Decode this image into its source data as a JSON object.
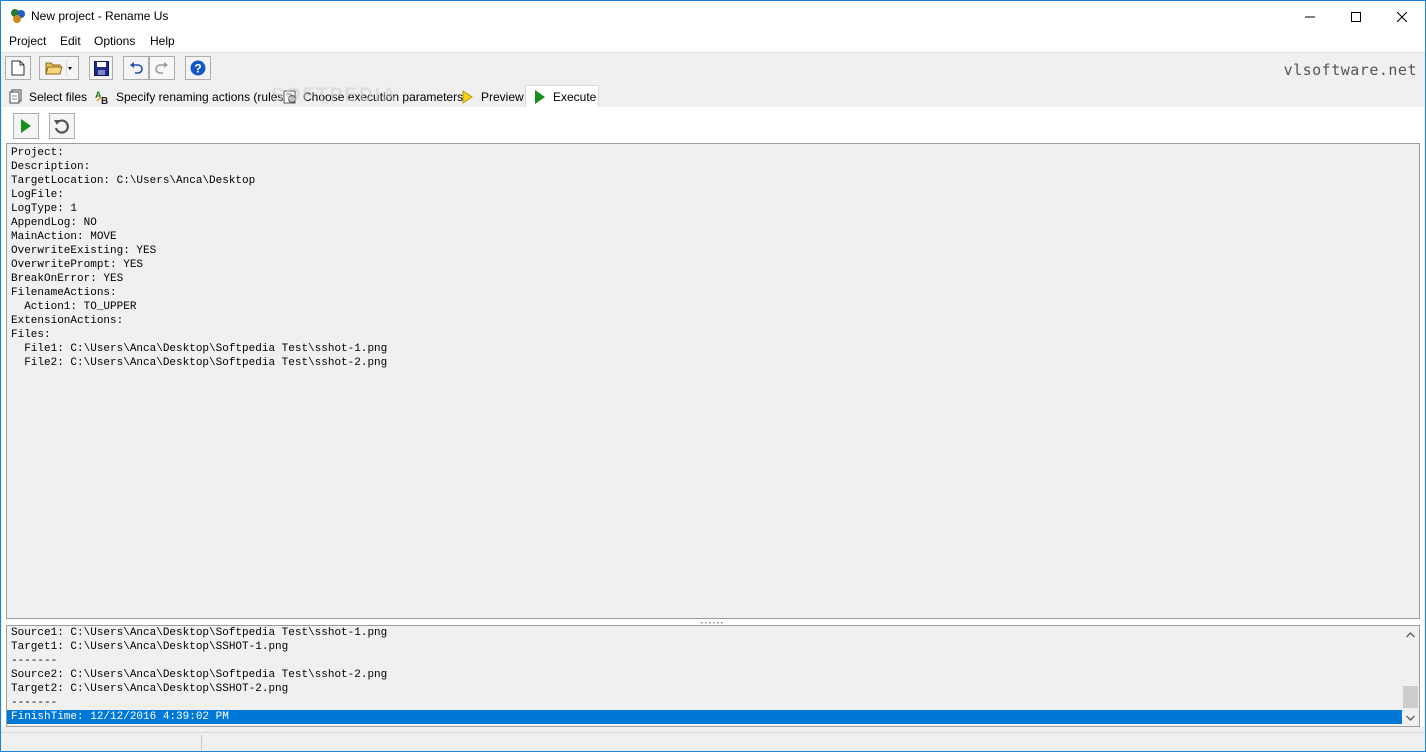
{
  "window": {
    "title": "New project - Rename Us"
  },
  "menu": [
    "Project",
    "Edit",
    "Options",
    "Help"
  ],
  "toolbar": {
    "brand": "vlsoftware.net"
  },
  "tabs": [
    {
      "label": "Select files",
      "icon": "files-icon"
    },
    {
      "label": "Specify renaming actions (rules)",
      "icon": "ab-rules-icon"
    },
    {
      "label": "Choose execution parameters",
      "icon": "parameters-icon"
    },
    {
      "label": "Preview",
      "icon": "preview-icon"
    },
    {
      "label": "Execute",
      "icon": "execute-icon",
      "active": true
    }
  ],
  "watermark": "SOFTPEDIA",
  "report_lines": [
    "Project:",
    "Description:",
    "TargetLocation: C:\\Users\\Anca\\Desktop",
    "LogFile:",
    "LogType: 1",
    "AppendLog: NO",
    "MainAction: MOVE",
    "OverwriteExisting: YES",
    "OverwritePrompt: YES",
    "BreakOnError: YES",
    "FilenameActions:",
    "  Action1: TO_UPPER",
    "ExtensionActions:",
    "Files:",
    "  File1: C:\\Users\\Anca\\Desktop\\Softpedia Test\\sshot-1.png",
    "  File2: C:\\Users\\Anca\\Desktop\\Softpedia Test\\sshot-2.png"
  ],
  "log_lines": [
    "Source1: C:\\Users\\Anca\\Desktop\\Softpedia Test\\sshot-1.png",
    "Target1: C:\\Users\\Anca\\Desktop\\SSHOT-1.png",
    "-------",
    "Source2: C:\\Users\\Anca\\Desktop\\Softpedia Test\\sshot-2.png",
    "Target2: C:\\Users\\Anca\\Desktop\\SSHOT-2.png",
    "-------",
    "FinishTime: 12/12/2016 4:39:02 PM"
  ],
  "log_selected_index": 6,
  "colors": {
    "accent": "#0078d7",
    "execute_green": "#1a8f1a"
  }
}
